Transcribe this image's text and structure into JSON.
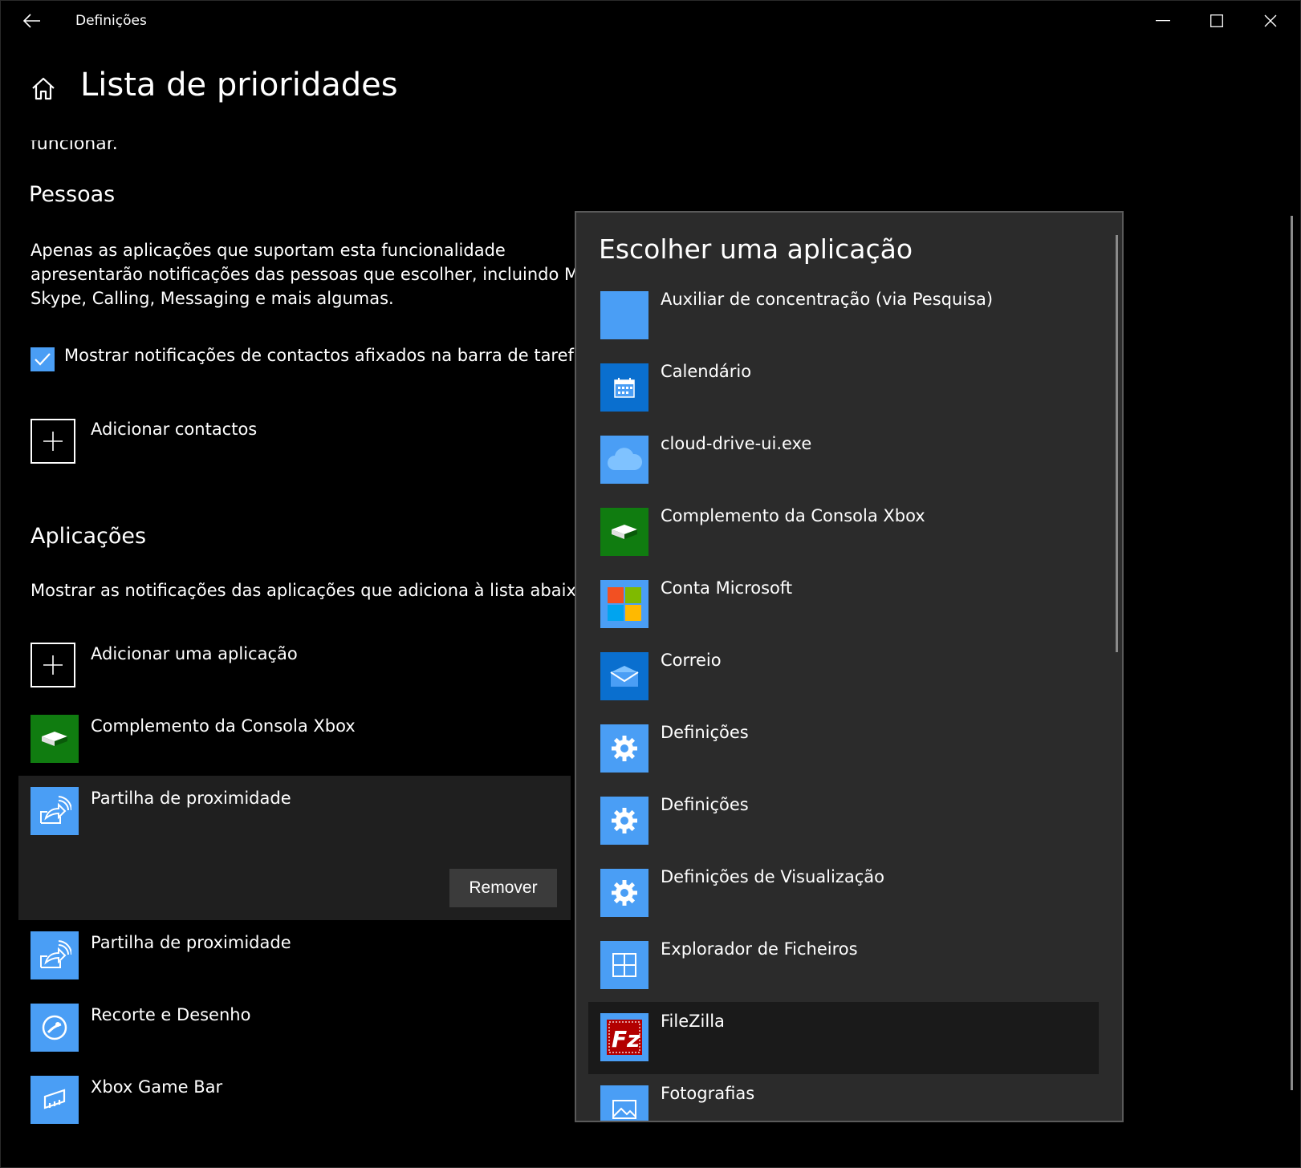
{
  "window": {
    "title": "Definições"
  },
  "page": {
    "title": "Lista de prioridades",
    "cut_text": "funcionar."
  },
  "people": {
    "title": "Pessoas",
    "description": [
      "Apenas as aplicações que suportam esta funcionalidade",
      "apresentarão notificações das pessoas que escolher, incluindo Mail,",
      "Skype, Calling, Messaging e mais algumas."
    ],
    "checkbox_label": "Mostrar notificações de contactos afixados na barra de tarefas.",
    "checkbox_checked": true,
    "add_label": "Adicionar contactos"
  },
  "apps": {
    "title": "Aplicações",
    "description": "Mostrar as notificações das aplicações que adiciona à lista abaixo.",
    "add_label": "Adicionar uma aplicação",
    "items": [
      {
        "label": "Complemento da Consola Xbox",
        "icon": "xbox-companion-icon",
        "color": "#107c10"
      },
      {
        "label": "Partilha de proximidade",
        "icon": "nearby-share-icon",
        "color": "#4a9ef5"
      },
      {
        "label": "Partilha de proximidade",
        "icon": "nearby-share-icon",
        "color": "#4a9ef5"
      },
      {
        "label": "Recorte e Desenho",
        "icon": "snip-sketch-icon",
        "color": "#4a9ef5"
      },
      {
        "label": "Xbox Game Bar",
        "icon": "game-bar-icon",
        "color": "#4a9ef5"
      }
    ],
    "remove_label": "Remover"
  },
  "flyout": {
    "title": "Escolher uma aplicação",
    "items": [
      {
        "label": "Auxiliar de concentração (via Pesquisa)",
        "icon": "focus-assist-icon",
        "color": "#4a9ef5"
      },
      {
        "label": "Calendário",
        "icon": "calendar-icon",
        "color": "#0a6fcf"
      },
      {
        "label": "cloud-drive-ui.exe",
        "icon": "cloud-icon",
        "color": "#4a9ef5"
      },
      {
        "label": "Complemento da Consola Xbox",
        "icon": "xbox-companion-icon",
        "color": "#107c10"
      },
      {
        "label": "Conta Microsoft",
        "icon": "microsoft-logo-icon",
        "color": "#4a9ef5"
      },
      {
        "label": "Correio",
        "icon": "mail-icon",
        "color": "#0a6fcf"
      },
      {
        "label": "Definições",
        "icon": "settings-gear-icon",
        "color": "#4a9ef5"
      },
      {
        "label": "Definições",
        "icon": "settings-gear-icon",
        "color": "#4a9ef5"
      },
      {
        "label": "Definições de Visualização",
        "icon": "settings-gear-icon",
        "color": "#4a9ef5"
      },
      {
        "label": "Explorador de Ficheiros",
        "icon": "file-explorer-icon",
        "color": "#4a9ef5"
      },
      {
        "label": "FileZilla",
        "icon": "filezilla-icon",
        "color": "#b30000"
      },
      {
        "label": "Fotografias",
        "icon": "photos-icon",
        "color": "#4a9ef5"
      }
    ]
  },
  "colors": {
    "accent": "#4a9ef5",
    "background": "#000000",
    "flyout_bg": "#2b2b2b",
    "selected_bg": "#1f1f1f",
    "button_bg": "#3b3b3b"
  }
}
